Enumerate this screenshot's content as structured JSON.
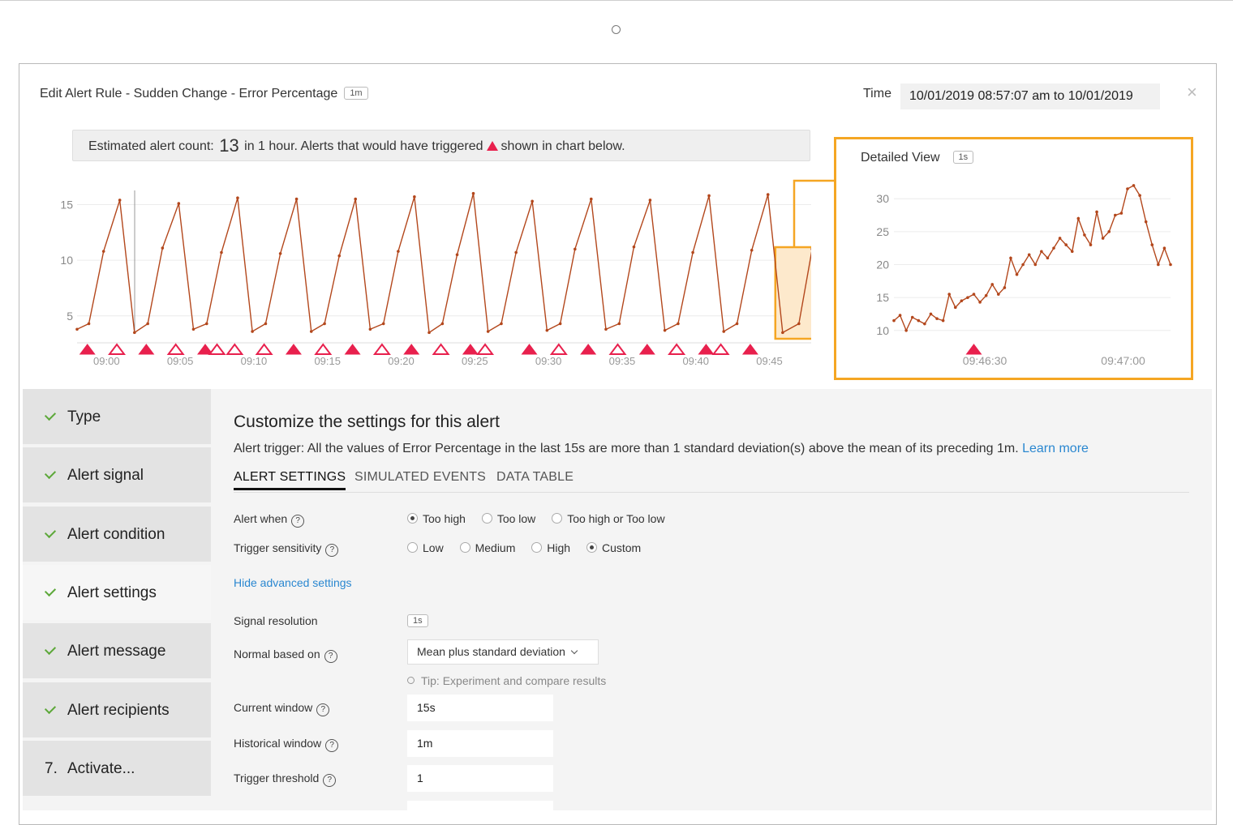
{
  "header": {
    "title": "Edit Alert Rule - Sudden Change - Error Percentage",
    "resolution_badge": "1m",
    "time_label": "Time",
    "time_range": "10/01/2019 08:57:07 am to 10/01/2019",
    "close_icon": "close-icon"
  },
  "estimate": {
    "prefix": "Estimated alert count:",
    "count": "13",
    "middle": "in 1 hour. Alerts that would have triggered",
    "suffix": "shown in chart below."
  },
  "detail": {
    "title": "Detailed View",
    "badge": "1s"
  },
  "colors": {
    "series": "#b3471c",
    "alert": "#e8204d",
    "highlight": "#f5a623"
  },
  "chart_data": [
    {
      "type": "line",
      "x_ticks": [
        "09:00",
        "09:05",
        "09:10",
        "09:15",
        "09:20",
        "09:25",
        "09:30",
        "09:35",
        "09:40",
        "09:45"
      ],
      "y_ticks": [
        5,
        10,
        15
      ],
      "ylim": [
        2.8,
        17
      ],
      "x_start_minutes": 8,
      "x_end_minutes": 58,
      "x_axis_origin_label": "09:00",
      "points": [
        [
          8.0,
          3.8
        ],
        [
          8.8,
          4.3
        ],
        [
          9.8,
          10.8
        ],
        [
          10.9,
          15.4
        ],
        [
          11.9,
          3.5
        ],
        [
          12.8,
          4.3
        ],
        [
          13.8,
          11.1
        ],
        [
          14.9,
          15.1
        ],
        [
          15.9,
          3.8
        ],
        [
          16.8,
          4.3
        ],
        [
          17.8,
          10.7
        ],
        [
          18.9,
          15.6
        ],
        [
          19.9,
          3.6
        ],
        [
          20.8,
          4.3
        ],
        [
          21.8,
          10.6
        ],
        [
          22.9,
          15.5
        ],
        [
          23.9,
          3.6
        ],
        [
          24.8,
          4.3
        ],
        [
          25.8,
          10.4
        ],
        [
          26.9,
          15.5
        ],
        [
          27.9,
          3.8
        ],
        [
          28.8,
          4.3
        ],
        [
          29.8,
          10.8
        ],
        [
          30.9,
          15.7
        ],
        [
          31.9,
          3.5
        ],
        [
          32.8,
          4.3
        ],
        [
          33.8,
          10.5
        ],
        [
          34.9,
          16.0
        ],
        [
          35.9,
          3.6
        ],
        [
          36.8,
          4.3
        ],
        [
          37.8,
          10.7
        ],
        [
          38.9,
          15.3
        ],
        [
          39.9,
          3.7
        ],
        [
          40.8,
          4.3
        ],
        [
          41.8,
          11.0
        ],
        [
          42.9,
          15.5
        ],
        [
          43.9,
          3.8
        ],
        [
          44.8,
          4.3
        ],
        [
          45.8,
          11.2
        ],
        [
          46.9,
          15.4
        ],
        [
          47.9,
          3.7
        ],
        [
          48.8,
          4.3
        ],
        [
          49.8,
          10.7
        ],
        [
          50.9,
          15.8
        ],
        [
          51.9,
          3.6
        ],
        [
          52.8,
          4.3
        ],
        [
          53.8,
          10.9
        ],
        [
          54.9,
          15.9
        ],
        [
          55.9,
          3.5
        ],
        [
          57.0,
          4.3
        ],
        [
          57.9,
          11.0
        ]
      ],
      "alerts": [
        {
          "x": 8.7,
          "filled": true
        },
        {
          "x": 10.7,
          "filled": false
        },
        {
          "x": 12.7,
          "filled": true
        },
        {
          "x": 14.7,
          "filled": false
        },
        {
          "x": 16.7,
          "filled": true
        },
        {
          "x": 17.5,
          "filled": false
        },
        {
          "x": 18.7,
          "filled": false
        },
        {
          "x": 20.7,
          "filled": false
        },
        {
          "x": 22.7,
          "filled": true
        },
        {
          "x": 24.7,
          "filled": false
        },
        {
          "x": 26.7,
          "filled": true
        },
        {
          "x": 28.7,
          "filled": false
        },
        {
          "x": 30.7,
          "filled": true
        },
        {
          "x": 32.7,
          "filled": false
        },
        {
          "x": 34.7,
          "filled": true
        },
        {
          "x": 35.7,
          "filled": false
        },
        {
          "x": 38.7,
          "filled": true
        },
        {
          "x": 40.7,
          "filled": false
        },
        {
          "x": 42.7,
          "filled": true
        },
        {
          "x": 44.7,
          "filled": false
        },
        {
          "x": 46.7,
          "filled": true
        },
        {
          "x": 48.7,
          "filled": false
        },
        {
          "x": 50.7,
          "filled": true
        },
        {
          "x": 51.7,
          "filled": false
        },
        {
          "x": 53.7,
          "filled": true
        }
      ],
      "highlight_x": [
        55.4,
        58.0
      ]
    },
    {
      "type": "line",
      "title": "Detailed View",
      "x_ticks": [
        "09:46:30",
        "09:47:00"
      ],
      "x_tick_values": [
        23,
        58
      ],
      "y_ticks": [
        10,
        15,
        20,
        25,
        30
      ],
      "ylim": [
        8.5,
        31.5
      ],
      "xlim": [
        0,
        70
      ],
      "values": [
        11.5,
        12.3,
        10,
        12,
        11.5,
        11,
        12.5,
        11.8,
        11.5,
        15.5,
        13.5,
        14.5,
        15,
        15.5,
        14.3,
        15.3,
        17,
        15.5,
        16.5,
        21,
        18.5,
        20,
        21.5,
        20,
        22,
        21,
        22.5,
        24,
        23,
        22,
        27,
        24.5,
        23,
        28,
        24,
        25,
        27.5,
        27.8,
        31.5,
        32,
        30.5,
        26.5,
        23,
        20,
        22.5,
        20
      ],
      "alerts": [
        {
          "index": 13,
          "filled": true
        }
      ]
    }
  ],
  "sidebar": {
    "items": [
      {
        "label": "Type",
        "icon": "check-icon"
      },
      {
        "label": "Alert signal",
        "icon": "check-icon"
      },
      {
        "label": "Alert condition",
        "icon": "check-icon"
      },
      {
        "label": "Alert settings",
        "icon": "check-icon"
      },
      {
        "label": "Alert message",
        "icon": "check-icon"
      },
      {
        "label": "Alert recipients",
        "icon": "check-icon"
      },
      {
        "num": "7.",
        "label": "Activate..."
      }
    ]
  },
  "main": {
    "title": "Customize the settings for this alert",
    "trigger_text": "Alert trigger: All the values of Error Percentage in the last 15s are more than 1 standard deviation(s) above the mean of its preceding 1m.",
    "learn_more": "Learn more",
    "tabs": [
      "ALERT SETTINGS",
      "SIMULATED EVENTS",
      "DATA TABLE"
    ],
    "alert_when": {
      "label": "Alert when",
      "options": [
        "Too high",
        "Too low",
        "Too high or Too low"
      ],
      "selected": 0
    },
    "sensitivity": {
      "label": "Trigger sensitivity",
      "options": [
        "Low",
        "Medium",
        "High",
        "Custom"
      ],
      "selected": 3
    },
    "advanced_link": "Hide advanced settings",
    "signal_resolution": {
      "label": "Signal resolution",
      "value": "1s"
    },
    "normal_based_on": {
      "label": "Normal based on",
      "value": "Mean plus standard deviation"
    },
    "tip": "Tip: Experiment and compare results",
    "current_window": {
      "label": "Current window",
      "value": "15s"
    },
    "historical_window": {
      "label": "Historical window",
      "value": "1m"
    },
    "trigger_threshold": {
      "label": "Trigger threshold",
      "value": "1"
    }
  }
}
